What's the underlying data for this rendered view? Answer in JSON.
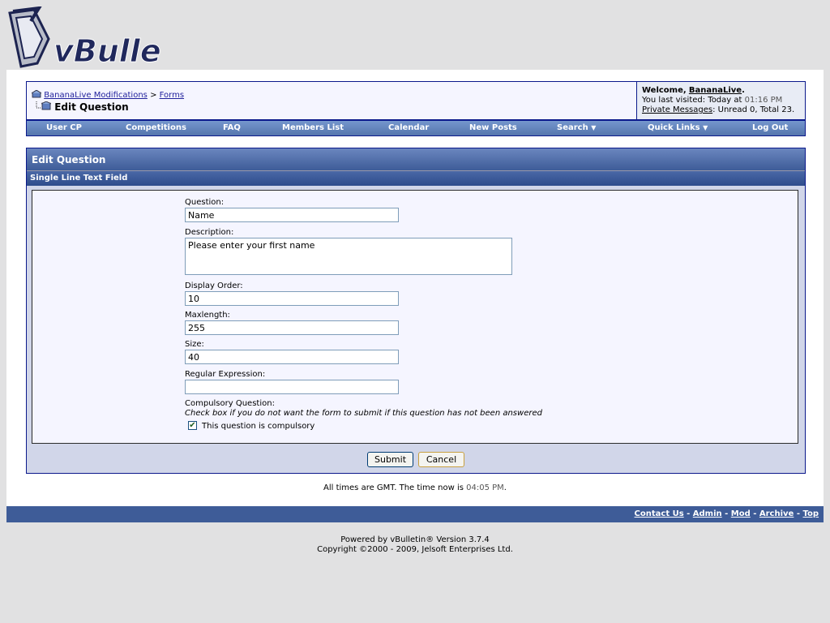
{
  "logo": {
    "text": "vBulletin"
  },
  "breadcrumb": {
    "forum": "BananaLive Modifications",
    "separator": ">",
    "section": "Forms",
    "current": "Edit Question"
  },
  "welcome": {
    "greeting": "Welcome,",
    "username": "BananaLive",
    "last_visit_label": "You last visited: Today at",
    "last_visit_time": "01:16 PM",
    "pm_label": "Private Messages",
    "pm_status": ": Unread 0, Total 23."
  },
  "navlinks": [
    "User CP",
    "Competitions",
    "FAQ",
    "Members List",
    "Calendar",
    "New Posts",
    "Search",
    "Quick Links",
    "Log Out"
  ],
  "panel": {
    "title": "Edit Question",
    "subtitle": "Single Line Text Field"
  },
  "form": {
    "question_label": "Question:",
    "question_value": "Name",
    "description_label": "Description:",
    "description_value": "Please enter your first name",
    "order_label": "Display Order:",
    "order_value": "10",
    "maxlength_label": "Maxlength:",
    "maxlength_value": "255",
    "size_label": "Size:",
    "size_value": "40",
    "regex_label": "Regular Expression:",
    "regex_value": "",
    "compulsory_label": "Compulsory Question:",
    "compulsory_hint": "Check box if you do not want the form to submit if this question has not been answered",
    "compulsory_check_label": "This question is compulsory",
    "compulsory_checked": true
  },
  "buttons": {
    "submit": "Submit",
    "cancel": "Cancel"
  },
  "timeline": {
    "prefix": "All times are GMT. The time now is",
    "time": "04:05 PM",
    "suffix": "."
  },
  "footer": {
    "links": [
      "Contact Us",
      "Admin",
      "Mod",
      "Archive",
      "Top"
    ],
    "separator": "-"
  },
  "copyright": {
    "line1": "Powered by vBulletin® Version 3.7.4",
    "line2": "Copyright ©2000 - 2009, Jelsoft Enterprises Ltd."
  },
  "colors": {
    "header_blue": "#3e5c98",
    "nav_blue": "#6e8fc5",
    "panel_bg": "#d1d6e9"
  }
}
